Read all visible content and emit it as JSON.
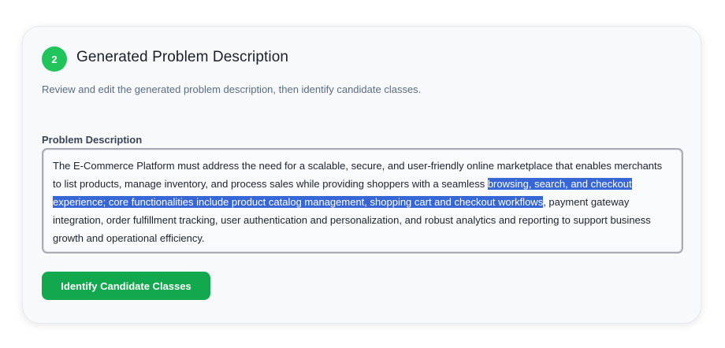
{
  "step": {
    "number": "2",
    "title": "Generated Problem Description",
    "subtitle": "Review and edit the generated problem description, then identify candidate classes."
  },
  "problem_description": {
    "label": "Problem Description",
    "text_before_selection": "The E-Commerce Platform must address the need for a scalable, secure, and user-friendly online marketplace that enables merchants to list products, manage inventory, and process sales while providing shoppers with a seamless ",
    "selected_text": "browsing, search, and checkout experience; core functionalities include product catalog management, shopping cart and checkout workflows",
    "text_after_selection": ", payment gateway integration, order fulfillment tracking, user authentication and personalization, and robust analytics and reporting to support business growth and operational efficiency."
  },
  "actions": {
    "identify_label": "Identify Candidate Classes"
  },
  "colors": {
    "step_badge": "#1fc45a",
    "button": "#12a84d",
    "selection": "#3767d6"
  }
}
